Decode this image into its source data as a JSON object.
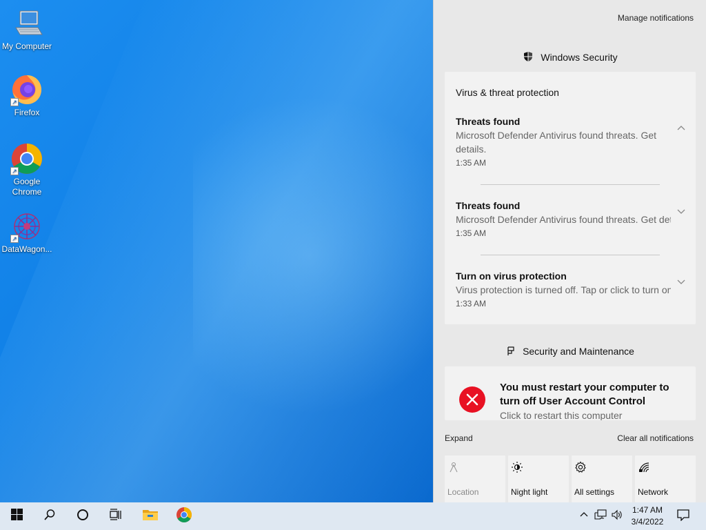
{
  "desktop": {
    "icons": [
      {
        "label": "My Computer",
        "icon": "computer-icon"
      },
      {
        "label": "Firefox",
        "icon": "firefox-icon"
      },
      {
        "label": "Google Chrome",
        "icon": "chrome-icon"
      },
      {
        "label": "DataWagon...",
        "icon": "datawagon-icon"
      }
    ]
  },
  "action_center": {
    "manage_label": "Manage notifications",
    "groups": [
      {
        "app": "Windows Security",
        "icon": "shield-icon",
        "card_title": "Virus & threat protection",
        "notifications": [
          {
            "title": "Threats found",
            "body": "Microsoft Defender Antivirus found threats. Get details.",
            "time": "1:35 AM",
            "expanded": true
          },
          {
            "title": "Threats found",
            "body": "Microsoft Defender Antivirus found threats. Get details.",
            "time": "1:35 AM",
            "expanded": false
          },
          {
            "title": "Turn on virus protection",
            "body": "Virus protection is turned off. Tap or click to turn on.",
            "time": "1:33 AM",
            "expanded": false
          }
        ]
      },
      {
        "app": "Security and Maintenance",
        "icon": "maintenance-icon",
        "notifications": [
          {
            "title": "You must restart your computer to turn off User Account Control",
            "body": "Click to restart this computer"
          }
        ]
      }
    ],
    "expand_label": "Expand",
    "clear_label": "Clear all notifications",
    "quick_actions": [
      {
        "label": "Location",
        "icon": "location-icon",
        "enabled": false
      },
      {
        "label": "Night light",
        "icon": "night-light-icon",
        "enabled": true
      },
      {
        "label": "All settings",
        "icon": "gear-icon",
        "enabled": true
      },
      {
        "label": "Network",
        "icon": "network-icon",
        "enabled": true
      }
    ]
  },
  "taskbar": {
    "time": "1:47 AM",
    "date": "3/4/2022",
    "accent": "#0078d7"
  }
}
